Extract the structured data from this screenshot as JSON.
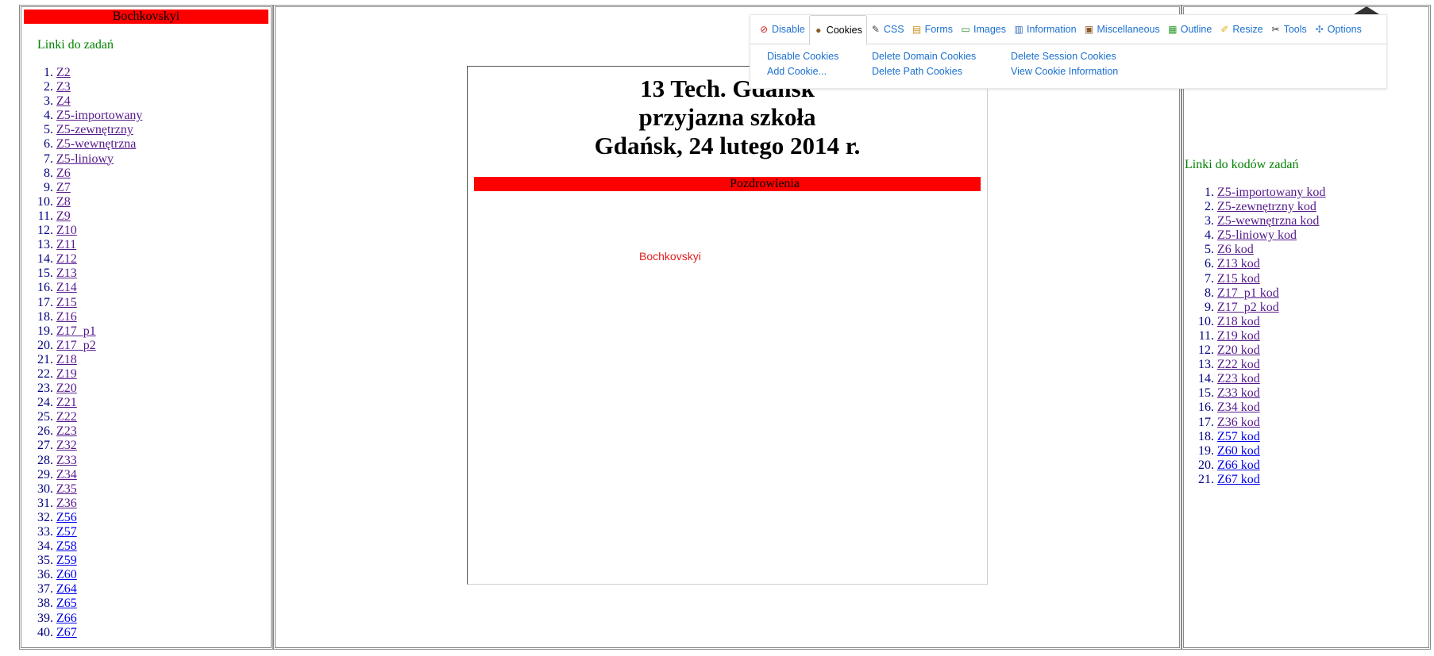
{
  "left_frame": {
    "banner": "Bochkovskyi",
    "heading": "Linki do zadań",
    "links": [
      {
        "label": "Z2",
        "visited": true
      },
      {
        "label": "Z3",
        "visited": true
      },
      {
        "label": "Z4",
        "visited": true
      },
      {
        "label": "Z5-importowany",
        "visited": true
      },
      {
        "label": "Z5-zewnętrzny",
        "visited": true
      },
      {
        "label": "Z5-wewnętrzna",
        "visited": true
      },
      {
        "label": "Z5-liniowy",
        "visited": true
      },
      {
        "label": "Z6",
        "visited": true
      },
      {
        "label": "Z7",
        "visited": true
      },
      {
        "label": "Z8",
        "visited": true
      },
      {
        "label": "Z9",
        "visited": true
      },
      {
        "label": "Z10",
        "visited": true
      },
      {
        "label": "Z11",
        "visited": true
      },
      {
        "label": "Z12",
        "visited": true
      },
      {
        "label": "Z13",
        "visited": true
      },
      {
        "label": "Z14",
        "visited": true
      },
      {
        "label": "Z15",
        "visited": true
      },
      {
        "label": "Z16",
        "visited": true
      },
      {
        "label": "Z17_p1",
        "visited": true
      },
      {
        "label": "Z17_p2",
        "visited": true
      },
      {
        "label": "Z18",
        "visited": true
      },
      {
        "label": "Z19",
        "visited": true
      },
      {
        "label": "Z20",
        "visited": true
      },
      {
        "label": "Z21",
        "visited": true
      },
      {
        "label": "Z22",
        "visited": true
      },
      {
        "label": "Z23",
        "visited": true
      },
      {
        "label": "Z32",
        "visited": true
      },
      {
        "label": "Z33",
        "visited": true
      },
      {
        "label": "Z34",
        "visited": true
      },
      {
        "label": "Z35",
        "visited": true
      },
      {
        "label": "Z36",
        "visited": true
      },
      {
        "label": "Z56",
        "visited": false
      },
      {
        "label": "Z57",
        "visited": false
      },
      {
        "label": "Z58",
        "visited": false
      },
      {
        "label": "Z59",
        "visited": false
      },
      {
        "label": "Z60",
        "visited": false
      },
      {
        "label": "Z64",
        "visited": false
      },
      {
        "label": "Z65",
        "visited": false
      },
      {
        "label": "Z66",
        "visited": false
      },
      {
        "label": "Z67",
        "visited": false
      }
    ]
  },
  "center_frame": {
    "headline": [
      "13 Tech. Gdańsk",
      "przyjazna szkoła",
      "Gdańsk, 24 lutego 2014 r."
    ],
    "banner": "Pozdrowienia",
    "signature": "Bochkovskyi"
  },
  "right_frame": {
    "heading": "Linki do kodów zadań",
    "links": [
      {
        "label": "Z5-importowany kod",
        "visited": true
      },
      {
        "label": "Z5-zewnętrzny kod",
        "visited": true
      },
      {
        "label": "Z5-wewnętrzna kod",
        "visited": true
      },
      {
        "label": "Z5-liniowy kod",
        "visited": true
      },
      {
        "label": "Z6 kod",
        "visited": true
      },
      {
        "label": "Z13 kod",
        "visited": true
      },
      {
        "label": "Z15 kod",
        "visited": true
      },
      {
        "label": "Z17_p1 kod",
        "visited": true
      },
      {
        "label": "Z17_p2 kod",
        "visited": true
      },
      {
        "label": "Z18 kod",
        "visited": true
      },
      {
        "label": "Z19 kod",
        "visited": true
      },
      {
        "label": "Z20 kod",
        "visited": true
      },
      {
        "label": "Z22 kod",
        "visited": true
      },
      {
        "label": "Z23 kod",
        "visited": true
      },
      {
        "label": "Z33 kod",
        "visited": true
      },
      {
        "label": "Z34 kod",
        "visited": true
      },
      {
        "label": "Z36 kod",
        "visited": true
      },
      {
        "label": "Z57 kod",
        "visited": false
      },
      {
        "label": "Z60 kod",
        "visited": false
      },
      {
        "label": "Z66 kod",
        "visited": false
      },
      {
        "label": "Z67 kod",
        "visited": false
      }
    ]
  },
  "devbar": {
    "tabs": [
      {
        "label": "Disable",
        "icon": "disable-icon",
        "glyph": "⊘",
        "color": "#d02020",
        "active": false
      },
      {
        "label": "Cookies",
        "icon": "cookie-icon",
        "glyph": "●",
        "color": "#8b5a2b",
        "active": true
      },
      {
        "label": "CSS",
        "icon": "css-wand-icon",
        "glyph": "✎",
        "color": "#444444",
        "active": false
      },
      {
        "label": "Forms",
        "icon": "forms-icon",
        "glyph": "▤",
        "color": "#c89020",
        "active": false
      },
      {
        "label": "Images",
        "icon": "images-icon",
        "glyph": "▭",
        "color": "#2a8a2a",
        "active": false
      },
      {
        "label": "Information",
        "icon": "information-icon",
        "glyph": "▥",
        "color": "#3a70c0",
        "active": false
      },
      {
        "label": "Miscellaneous",
        "icon": "miscellaneous-icon",
        "glyph": "▣",
        "color": "#8b5a2b",
        "active": false
      },
      {
        "label": "Outline",
        "icon": "outline-icon",
        "glyph": "▦",
        "color": "#2a9a2a",
        "active": false
      },
      {
        "label": "Resize",
        "icon": "resize-icon",
        "glyph": "✐",
        "color": "#e0b020",
        "active": false
      },
      {
        "label": "Tools",
        "icon": "tools-icon",
        "glyph": "✂",
        "color": "#333333",
        "active": false
      },
      {
        "label": "Options",
        "icon": "options-icon",
        "glyph": "✣",
        "color": "#3a80d0",
        "active": false
      }
    ],
    "menu": [
      {
        "label": "Disable Cookies",
        "name": "disable-cookies-item"
      },
      {
        "label": "Delete Domain Cookies",
        "name": "delete-domain-cookies-item"
      },
      {
        "label": "Delete Session Cookies",
        "name": "delete-session-cookies-item"
      },
      {
        "label": "Add Cookie...",
        "name": "add-cookie-item"
      },
      {
        "label": "Delete Path Cookies",
        "name": "delete-path-cookies-item"
      },
      {
        "label": "View Cookie Information",
        "name": "view-cookie-information-item"
      }
    ]
  },
  "colors": {
    "banner_red": "#ff0000",
    "heading_green": "#008000",
    "link_visited": "#551a8b",
    "link_unvisited": "#0000ee",
    "toolbar_link": "#1a6fd0"
  }
}
